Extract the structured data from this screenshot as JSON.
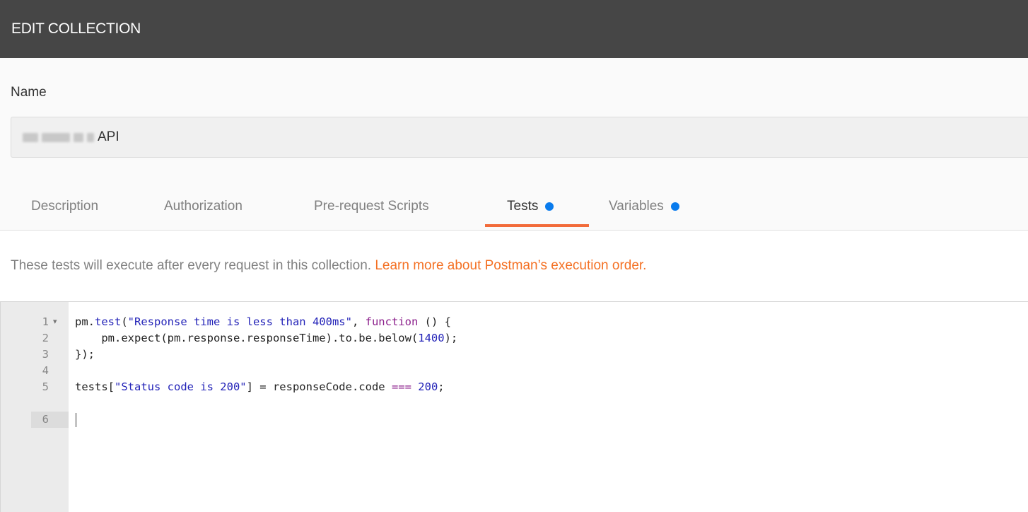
{
  "header": {
    "title": "EDIT COLLECTION"
  },
  "name_field": {
    "label": "Name",
    "value_suffix": "API"
  },
  "tabs": [
    {
      "label": "Description",
      "active": false,
      "dot": false
    },
    {
      "label": "Authorization",
      "active": false,
      "dot": false
    },
    {
      "label": "Pre-request Scripts",
      "active": false,
      "dot": false
    },
    {
      "label": "Tests",
      "active": true,
      "dot": true
    },
    {
      "label": "Variables",
      "active": false,
      "dot": true
    }
  ],
  "info": {
    "text": "These tests will execute after every request in this collection. ",
    "link": "Learn more about Postman’s execution order."
  },
  "editor": {
    "line_numbers": [
      "1",
      "2",
      "3",
      "4",
      "5",
      "6"
    ],
    "lines": {
      "l1_a": "pm.",
      "l1_b": "test",
      "l1_c": "(",
      "l1_d": "\"Response time is less than 400ms\"",
      "l1_e": ", ",
      "l1_f": "function",
      "l1_g": " () {",
      "l2_a": "    pm.expect(pm.response.responseTime).to.be.below(",
      "l2_b": "1400",
      "l2_c": ");",
      "l3": "});",
      "l5_a": "tests[",
      "l5_b": "\"Status code is 200\"",
      "l5_c": "] = responseCode.code ",
      "l5_d": "===",
      "l5_e": " ",
      "l5_f": "200",
      "l5_g": ";"
    }
  },
  "colors": {
    "header_bg": "#464646",
    "accent_orange": "#f26b3a",
    "dot_blue": "#097bed",
    "link_orange": "#f47023"
  }
}
